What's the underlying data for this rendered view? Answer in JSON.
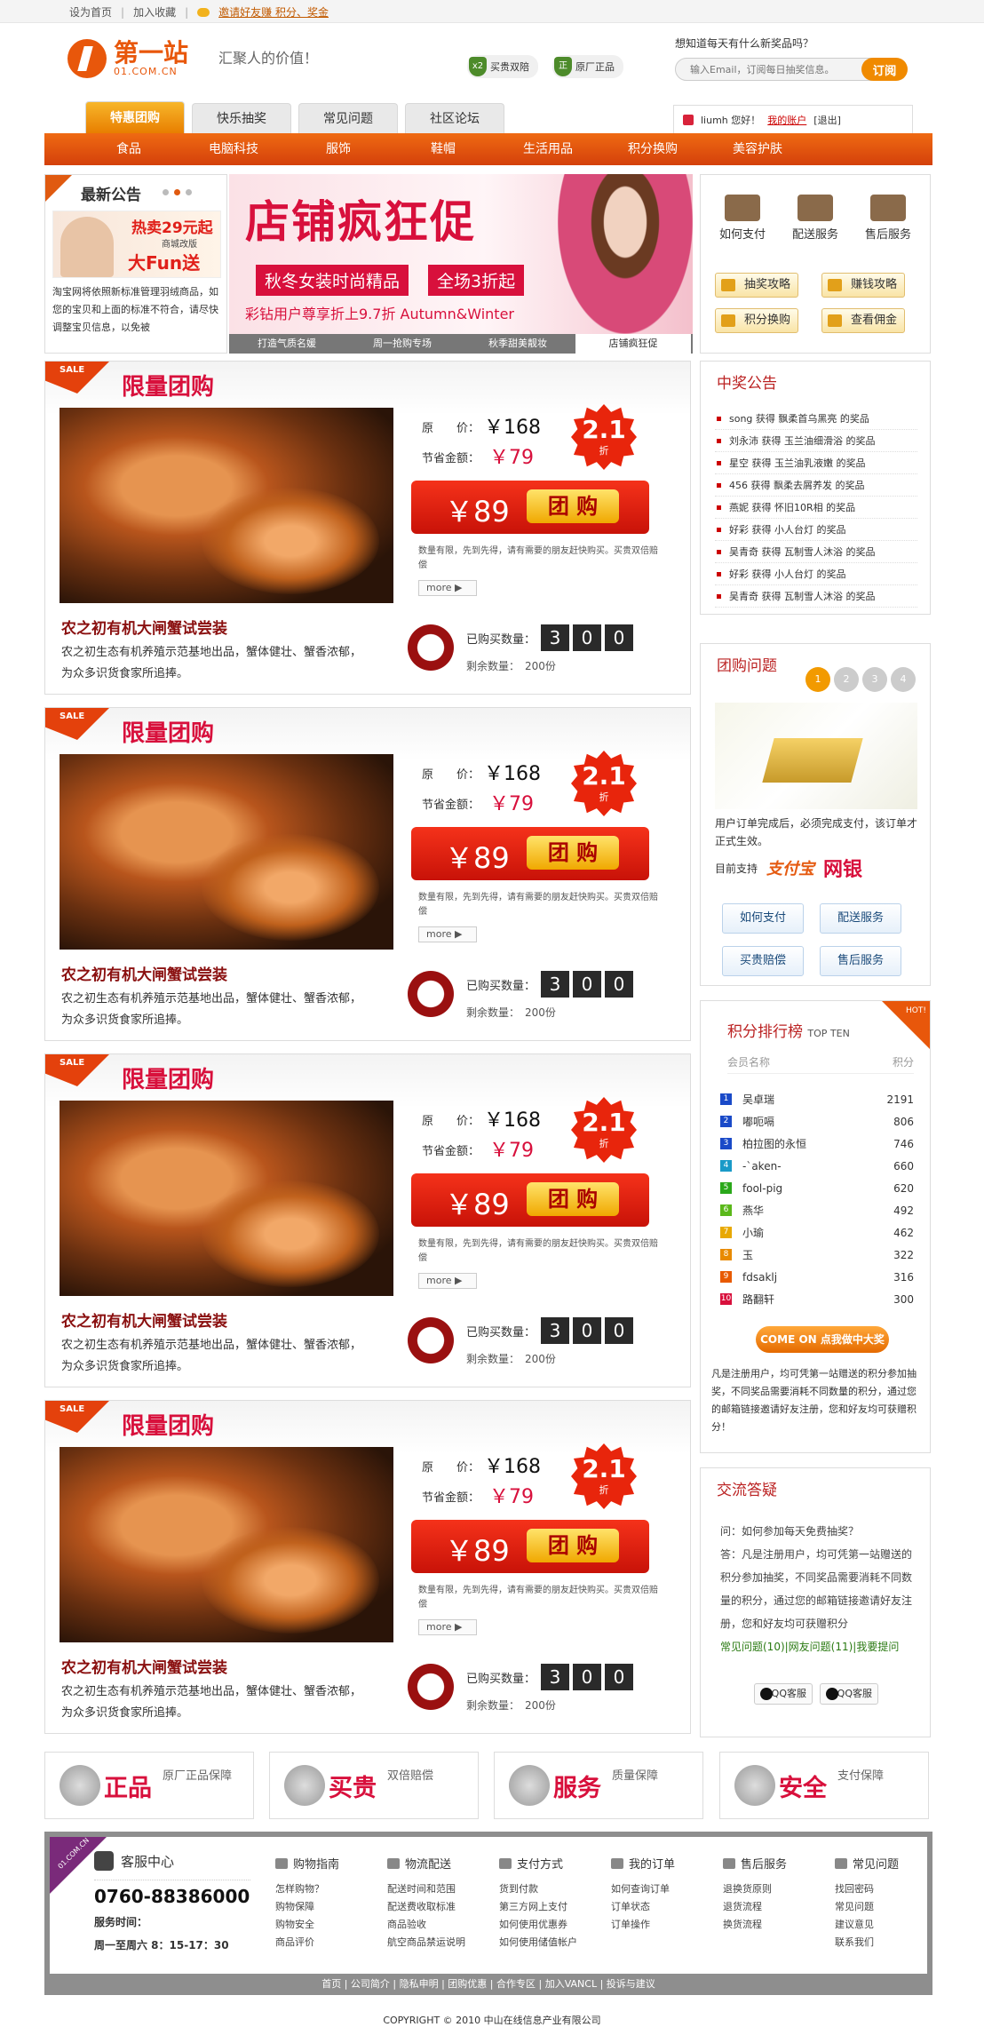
{
  "topbar": {
    "home": "设为首页",
    "fav": "加入收藏",
    "invite": "邀请好友赚 积分、奖金"
  },
  "header": {
    "logo_name": "第一站",
    "logo_domain": "01.COM.CN",
    "slogan": "汇聚人的价值！",
    "badge1_icon": "x2",
    "badge1": "买贵双陪",
    "badge2_icon": "正",
    "badge2": "原厂正品",
    "subscribe_q": "想知道每天有什么新奖品吗？",
    "subscribe_placeholder": "输入Email，订阅每日抽奖信息。",
    "subscribe_btn": "订阅"
  },
  "tabs": [
    "特惠团购",
    "快乐抽奖",
    "常见问题",
    "社区论坛"
  ],
  "user": {
    "name": "liumh 您好！",
    "account": "我的账户",
    "logout": "[退出]"
  },
  "categories": [
    "食品",
    "电脑科技",
    "服饰",
    "鞋帽",
    "生活用品",
    "积分换购",
    "美容护肤"
  ],
  "news": {
    "title": "最新公告",
    "promo_t1": "热卖29元起",
    "promo_t2": "商城改版",
    "promo_t3": "大Fun送",
    "text": "淘宝网将依照新标准管理羽绒商品，如您的宝贝和上面的标准不符合，请尽快调整宝贝信息，以免被"
  },
  "banner": {
    "big": "店铺疯狂促",
    "mid": "秋冬女装时尚精品",
    "mid2": "全场3折起",
    "sub": "彩钻用户尊享折上9.7折 Autumn&Winter",
    "strip": [
      "打造气质名媛",
      "周一抢购专场",
      "秋季甜美靓妆",
      "店铺疯狂促"
    ]
  },
  "services": {
    "icons": [
      "如何支付",
      "配送服务",
      "售后服务"
    ],
    "buttons": [
      "抽奖攻略",
      "赚钱攻略",
      "积分换购",
      "查看佣金"
    ]
  },
  "deal": {
    "sale": "SALE",
    "title": "限量团购",
    "name": "农之初有机大闸蟹试尝装",
    "desc": "农之初生态有机养殖示范基地出品，蟹体健壮、蟹香浓郁，为众多识货食家所追捧。",
    "orig_label": "原　　价：",
    "orig": "￥168",
    "save_label": "节省金额：",
    "save": "￥79",
    "discount": "2.1",
    "discount_unit": "折",
    "price": "￥89",
    "buy": "团 购",
    "note": "数量有限，先到先得，请有需要的朋友赶快购买。买贵双倍赔偿",
    "more": "more ▶",
    "bought_label": "已购买数量：",
    "digits": [
      "3",
      "0",
      "0"
    ],
    "remain": "剩余数量：　200份"
  },
  "winners": {
    "title": "中奖公告",
    "items": [
      "song 获得 飘柔首乌黑亮 的奖品",
      "刘永沛 获得 玉兰油细滑浴 的奖品",
      "星空 获得 玉兰油乳液嫩 的奖品",
      "456 获得 飘柔去屑养发 的奖品",
      "燕妮 获得 怀旧10R相 的奖品",
      "好彩 获得 小人台灯 的奖品",
      "吴青奇 获得 瓦制雪人沐浴 的奖品",
      "好彩 获得 小人台灯 的奖品",
      "吴青奇 获得 瓦制雪人沐浴 的奖品"
    ]
  },
  "faq": {
    "title": "团购问题",
    "steps": [
      "1",
      "2",
      "3",
      "4"
    ],
    "text": "用户订单完成后，必须完成支付，该订单才正式生效。",
    "support": "目前支持",
    "alipay": "支付宝",
    "bank": "网银",
    "buttons": [
      "如何支付",
      "配送服务",
      "买贵赔偿",
      "售后服务"
    ]
  },
  "rank": {
    "title": "积分排行榜",
    "subtitle": "TOP TEN",
    "hot": "HOT!",
    "col_name": "会员名称",
    "col_pts": "积分",
    "items": [
      {
        "no": "1",
        "name": "吴卓瑞",
        "pts": "2191",
        "color": "#1a4ac8"
      },
      {
        "no": "2",
        "name": "嘟呃嗝",
        "pts": "806",
        "color": "#1a4ac8"
      },
      {
        "no": "3",
        "name": "柏拉图的永恒",
        "pts": "746",
        "color": "#1a4ac8"
      },
      {
        "no": "4",
        "name": "-`aken-",
        "pts": "660",
        "color": "#1a9ac8"
      },
      {
        "no": "5",
        "name": "fool-pig",
        "pts": "620",
        "color": "#2aa81a"
      },
      {
        "no": "6",
        "name": "燕华",
        "pts": "492",
        "color": "#5ab81a"
      },
      {
        "no": "7",
        "name": "小瑜",
        "pts": "462",
        "color": "#e8a800"
      },
      {
        "no": "8",
        "name": "玉",
        "pts": "322",
        "color": "#e88a00"
      },
      {
        "no": "9",
        "name": "fdsaklj",
        "pts": "316",
        "color": "#e85a00"
      },
      {
        "no": "10",
        "name": "路翻轩",
        "pts": "300",
        "color": "#d8103c"
      }
    ],
    "comeon": "COME ON 点我做中大奖",
    "note": "凡是注册用户，均可凭第一站赠送的积分参加抽奖，不同奖品需要消耗不同数量的积分，通过您的邮箱链接邀请好友注册，您和好友均可获赠积分！"
  },
  "qa": {
    "title": "交流答疑",
    "q": "问：如何参加每天免费抽奖？",
    "a": "答：凡是注册用户，均可凭第一站赠送的积分参加抽奖，不同奖品需要消耗不同数量的积分，通过您的邮箱链接邀请好友注册，您和好友均可获赠积分",
    "links": "常见问题(10)|网友问题(11)|我要提问",
    "qq": "QQ客服"
  },
  "guarantees": [
    {
      "t": "正品",
      "s": "原厂正品保障"
    },
    {
      "t": "买贵",
      "s": "双倍赔偿"
    },
    {
      "t": "服务",
      "s": "质量保障"
    },
    {
      "t": "安全",
      "s": "支付保障"
    }
  ],
  "footer": {
    "corner": "01.COM.CN",
    "cs_title": "客服中心",
    "tel": "0760-88386000",
    "time_label": "服务时间：",
    "time": "周一至周六 8：15-17：30",
    "cols": [
      {
        "h": "购物指南",
        "items": [
          "怎样购物？",
          "购物保障",
          "购物安全",
          "商品评价"
        ]
      },
      {
        "h": "物流配送",
        "items": [
          "配送时间和范围",
          "配送费收取标准",
          "商品验收",
          "航空商品禁运说明"
        ]
      },
      {
        "h": "支付方式",
        "items": [
          "货到付款",
          "第三方网上支付",
          "如何使用优惠券",
          "如何使用储值帐户"
        ]
      },
      {
        "h": "我的订单",
        "items": [
          "如何查询订单",
          "订单状态",
          "订单操作"
        ]
      },
      {
        "h": "售后服务",
        "items": [
          "退换货原则",
          "退货流程",
          "换货流程"
        ]
      },
      {
        "h": "常见问题",
        "items": [
          "找回密码",
          "常见问题",
          "建议意见",
          "联系我们"
        ]
      }
    ],
    "links": "首页 | 公司简介 | 隐私申明 | 团购优惠 | 合作专区 | 加入VANCL | 投诉与建议",
    "copyright": "COPYRIGHT © 2010 中山在线信息产业有限公司"
  }
}
